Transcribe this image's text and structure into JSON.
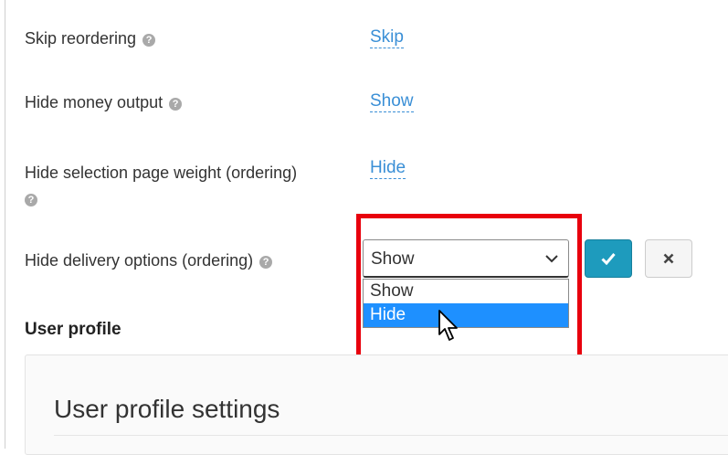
{
  "settings": [
    {
      "label": "Skip reordering",
      "value": "Skip"
    },
    {
      "label": "Hide money output",
      "value": "Show"
    },
    {
      "label": "Hide selection page weight (ordering)",
      "value": "Hide"
    },
    {
      "label": "Hide delivery options (ordering)"
    }
  ],
  "delivery_select": {
    "current": "Show",
    "options": [
      "Show",
      "Hide"
    ],
    "highlighted": "Hide"
  },
  "section": {
    "title": "User profile"
  },
  "panel": {
    "title": "User profile settings"
  },
  "icons": {
    "help": "question-circle-icon",
    "confirm": "check-icon",
    "cancel": "close-icon",
    "dropdown": "chevron-down-icon",
    "pointer": "mouse-cursor-icon"
  },
  "colors": {
    "link": "#3a8fd6",
    "highlight": "#e8000d",
    "option_selected": "#1e90ff",
    "confirm_button": "#1e9bbd"
  }
}
